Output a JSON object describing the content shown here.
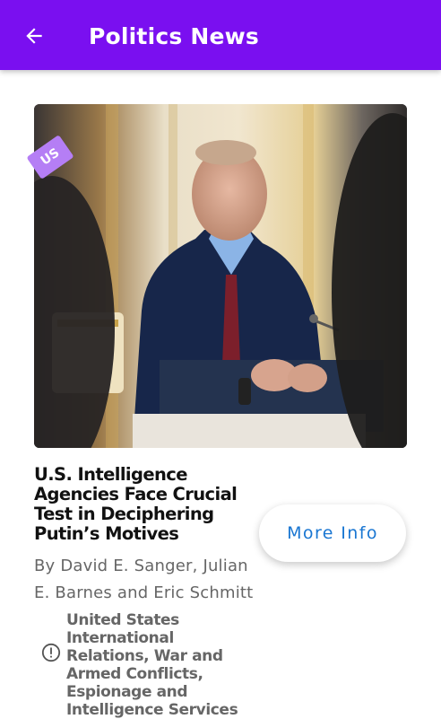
{
  "appbar": {
    "title": "Politics News",
    "back_icon": "arrow-back-icon",
    "background": "#7a0ff0"
  },
  "article": {
    "badge": "US",
    "badge_color": "#b57ef5",
    "headline": "U.S. Intelligence Agencies Face Crucial Test in Deciphering Putin’s Motives",
    "byline": "By David E. Sanger, Julian E. Barnes and Eric Schmitt",
    "more_info_label": "More Info",
    "more_info_color": "#1976d2",
    "tags_icon": "info-icon",
    "tags": "United States International Relations, War and Armed Conflicts, Espionage and Intelligence Services"
  }
}
